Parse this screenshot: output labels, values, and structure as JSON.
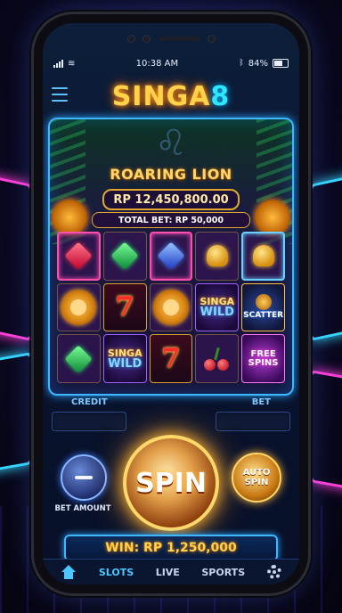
{
  "status": {
    "time": "10:38 AM",
    "battery": "84%"
  },
  "brand": {
    "name": "SINGA",
    "number": "8"
  },
  "game": {
    "title": "ROARING LION",
    "jackpot": "RP 12,450,800.00",
    "total_bet": "TOTAL BET: RP 50,000"
  },
  "reels": [
    {
      "symbol": "red-gem"
    },
    {
      "symbol": "green-gem"
    },
    {
      "symbol": "blue-gem"
    },
    {
      "symbol": "bell"
    },
    {
      "symbol": "bell"
    },
    {
      "symbol": "lion"
    },
    {
      "symbol": "seven",
      "text": "7"
    },
    {
      "symbol": "lion"
    },
    {
      "symbol": "wild",
      "line1": "SINGA",
      "line2": "WILD"
    },
    {
      "symbol": "scatter",
      "text": "SCATTER"
    },
    {
      "symbol": "green-gem"
    },
    {
      "symbol": "wild",
      "line1": "SINGA",
      "line2": "WILD"
    },
    {
      "symbol": "seven",
      "text": "7"
    },
    {
      "symbol": "cherry"
    },
    {
      "symbol": "free-spins",
      "line1": "FREE",
      "line2": "SPINS"
    }
  ],
  "controls": {
    "credit_label": "CREDIT",
    "bet_label": "BET",
    "bet_amount_label": "BET AMOUNT",
    "spin_label": "SPIN",
    "auto_spin_line1": "AUTO",
    "auto_spin_line2": "SPIN"
  },
  "win": "WIN: RP 1,250,000",
  "tabs": {
    "slots": "SLOTS",
    "live": "LIVE",
    "sports": "SPORTS"
  },
  "colors": {
    "accent": "#4ac8ff",
    "gold": "#ffd24a",
    "neon_pink": "#ff3fd8"
  }
}
